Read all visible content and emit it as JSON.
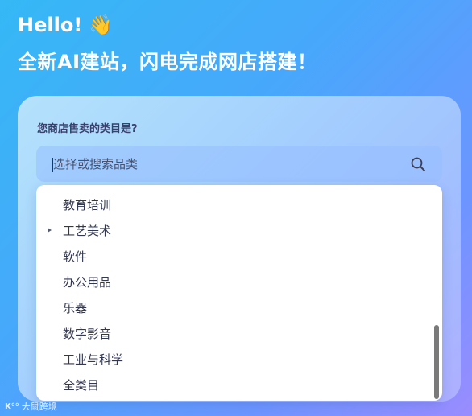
{
  "header": {
    "greeting": "Hello!",
    "wave_emoji": "👋",
    "headline": "全新AI建站，闪电完成网店搭建！"
  },
  "form": {
    "question": "您商店售卖的类目是?",
    "search_placeholder": "选择或搜索品类"
  },
  "dropdown": {
    "options": [
      {
        "label": "教育培训",
        "has_children": false
      },
      {
        "label": "工艺美术",
        "has_children": true
      },
      {
        "label": "软件",
        "has_children": false
      },
      {
        "label": "办公用品",
        "has_children": false
      },
      {
        "label": "乐器",
        "has_children": false
      },
      {
        "label": "数字影音",
        "has_children": false
      },
      {
        "label": "工业与科学",
        "has_children": false
      },
      {
        "label": "全类目",
        "has_children": false
      }
    ]
  },
  "watermark": {
    "logo": "K°°",
    "text": "大鼠跨境"
  },
  "icons": {
    "search": "search-icon",
    "expand": "caret-right-icon"
  }
}
